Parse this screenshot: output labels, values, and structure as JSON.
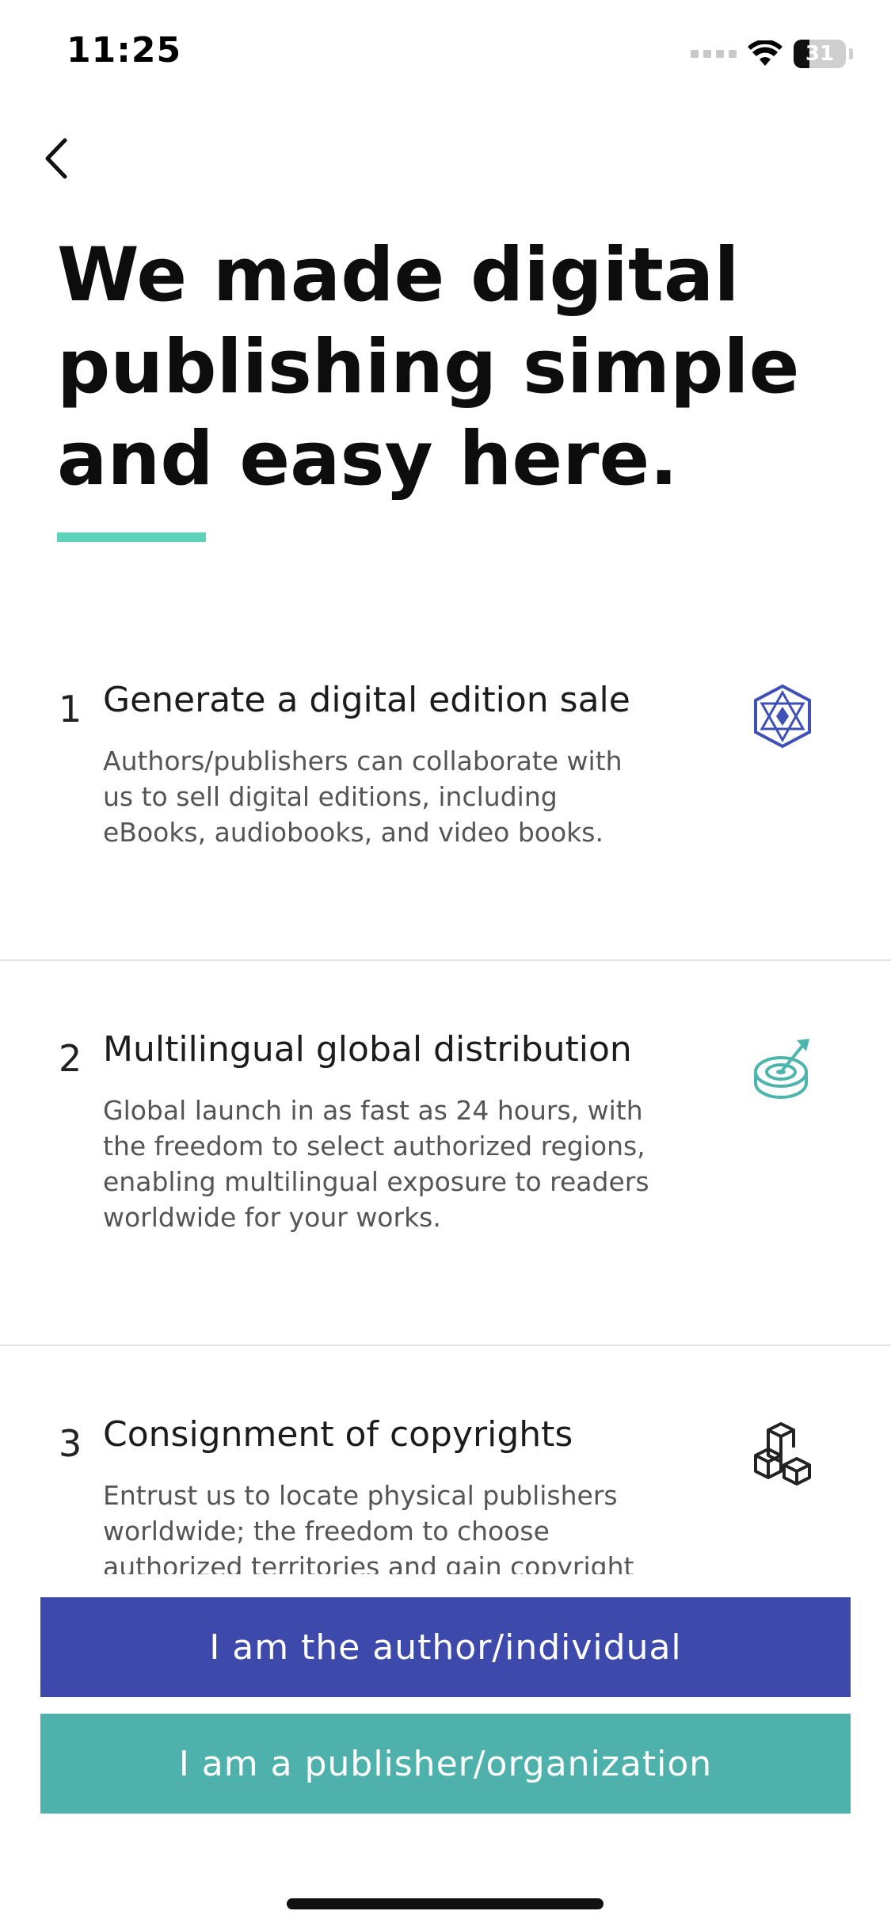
{
  "status_bar": {
    "time": "11:25",
    "battery_level": "31",
    "battery_fraction": 0.31
  },
  "nav": {
    "back_icon": "chevron-left-icon"
  },
  "headline": {
    "text": "We made digital publishing simple and easy here.",
    "accent_color": "#5ed3b9"
  },
  "steps": [
    {
      "number": "1",
      "title": "Generate a digital edition sale",
      "description": "Authors/publishers can collaborate with us to sell digital editions, including eBooks, audiobooks, and video books.",
      "icon": "gem-icon",
      "icon_color": "#3f51b5"
    },
    {
      "number": "2",
      "title": "Multilingual global distribution",
      "description": "Global launch in as fast as 24 hours, with the freedom to select authorized regions, enabling multilingual exposure to readers worldwide for your works.",
      "icon": "target-icon",
      "icon_color": "#4cb5ac"
    },
    {
      "number": "3",
      "title": "Consignment of copyrights",
      "description": "Entrust us to locate physical publishers worldwide; the freedom to choose authorized territories and gain copyright",
      "icon": "blocks-icon",
      "icon_color": "#222222"
    }
  ],
  "buttons": {
    "author": {
      "label": "I am the author/individual",
      "color": "#3d4aab"
    },
    "publisher": {
      "label": "I am a publisher/organization",
      "color": "#4fb1ab"
    }
  }
}
